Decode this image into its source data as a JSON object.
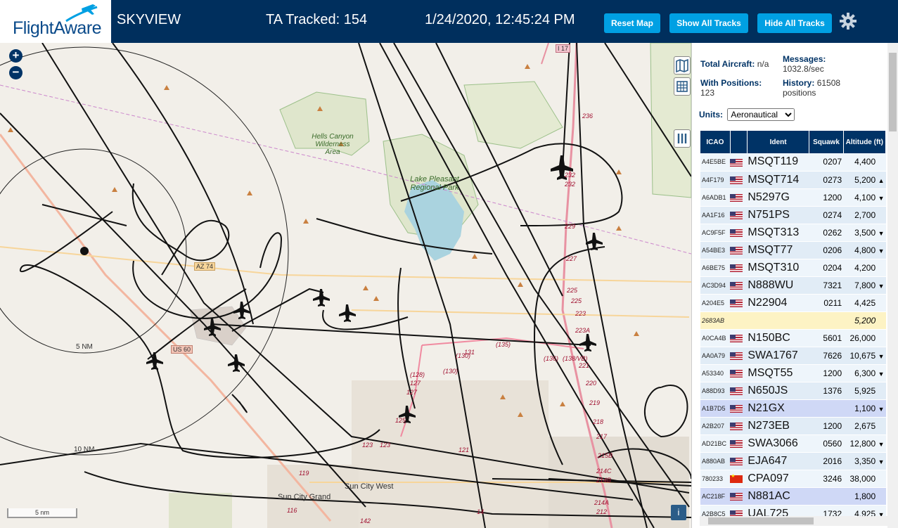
{
  "header": {
    "logo": "FlightAware",
    "app_name": "SKYVIEW",
    "tracked": "TA Tracked: 154",
    "datetime": "1/24/2020, 12:45:24 PM",
    "reset_label": "Reset Map",
    "show_label": "Show All Tracks",
    "hide_label": "Hide All Tracks",
    "accent": "#00a0e3",
    "bar_color": "#002f5d"
  },
  "map": {
    "labels": {
      "hells_canyon": "Hells Canyon Wilderness Area",
      "lake_pleasant": "Lake Pleasant Regional Park",
      "sun_city_west": "Sun City West",
      "sun_city_grand": "Sun City Grand",
      "ring_5": "5 NM",
      "ring_10": "10 NM",
      "az74": "AZ 74",
      "us60": "US 60",
      "i17": "I 17"
    },
    "scale": "5 nm",
    "info": "i",
    "zoom_in": "+",
    "zoom_out": "−"
  },
  "stats": {
    "total_label": "Total Aircraft:",
    "total_value": "n/a",
    "messages_label": "Messages:",
    "messages_value": "1032.8/sec",
    "positions_label": "With Positions:",
    "positions_value": "123",
    "history_label": "History:",
    "history_value": "61508",
    "history_unit": "positions"
  },
  "units": {
    "label": "Units:",
    "selected": "Aeronautical"
  },
  "table": {
    "columns": [
      "ICAO",
      "",
      "Ident",
      "Squawk",
      "Altitude (ft)"
    ],
    "rows": [
      {
        "icao": "A4E5BE",
        "flag": "us",
        "ident": "MSQT119",
        "squawk": "0207",
        "alt": "4,400",
        "trend": "",
        "state": ""
      },
      {
        "icao": "A4F179",
        "flag": "us",
        "ident": "MSQT714",
        "squawk": "0273",
        "alt": "5,200",
        "trend": "▲",
        "state": ""
      },
      {
        "icao": "A6ADB1",
        "flag": "us",
        "ident": "N5297G",
        "squawk": "1200",
        "alt": "4,100",
        "trend": "▼",
        "state": ""
      },
      {
        "icao": "AA1F16",
        "flag": "us",
        "ident": "N751PS",
        "squawk": "0274",
        "alt": "2,700",
        "trend": "",
        "state": ""
      },
      {
        "icao": "AC9F5F",
        "flag": "us",
        "ident": "MSQT313",
        "squawk": "0262",
        "alt": "3,500",
        "trend": "▼",
        "state": ""
      },
      {
        "icao": "A54BE3",
        "flag": "us",
        "ident": "MSQT77",
        "squawk": "0206",
        "alt": "4,800",
        "trend": "▼",
        "state": ""
      },
      {
        "icao": "A6BE75",
        "flag": "us",
        "ident": "MSQT310",
        "squawk": "0204",
        "alt": "4,200",
        "trend": "",
        "state": ""
      },
      {
        "icao": "AC3D94",
        "flag": "us",
        "ident": "N888WU",
        "squawk": "7321",
        "alt": "7,800",
        "trend": "▼",
        "state": ""
      },
      {
        "icao": "A204E5",
        "flag": "us",
        "ident": "N22904",
        "squawk": "0211",
        "alt": "4,425",
        "trend": "",
        "state": ""
      },
      {
        "icao": "2683AB",
        "flag": "",
        "ident": "",
        "squawk": "",
        "alt": "5,200",
        "trend": "",
        "state": "mlat"
      },
      {
        "icao": "A0CA4B",
        "flag": "us",
        "ident": "N150BC",
        "squawk": "5601",
        "alt": "26,000",
        "trend": "",
        "state": ""
      },
      {
        "icao": "AA0A79",
        "flag": "us",
        "ident": "SWA1767",
        "squawk": "7626",
        "alt": "10,675",
        "trend": "▼",
        "state": ""
      },
      {
        "icao": "A53340",
        "flag": "us",
        "ident": "MSQT55",
        "squawk": "1200",
        "alt": "6,300",
        "trend": "▼",
        "state": ""
      },
      {
        "icao": "A88D93",
        "flag": "us",
        "ident": "N650JS",
        "squawk": "1376",
        "alt": "5,925",
        "trend": "",
        "state": ""
      },
      {
        "icao": "A1B7D5",
        "flag": "us",
        "ident": "N21GX",
        "squawk": "",
        "alt": "1,100",
        "trend": "▼",
        "state": "sel"
      },
      {
        "icao": "A2B207",
        "flag": "us",
        "ident": "N273EB",
        "squawk": "1200",
        "alt": "2,675",
        "trend": "",
        "state": ""
      },
      {
        "icao": "AD21BC",
        "flag": "us",
        "ident": "SWA3066",
        "squawk": "0560",
        "alt": "12,800",
        "trend": "▼",
        "state": ""
      },
      {
        "icao": "A880AB",
        "flag": "us",
        "ident": "EJA647",
        "squawk": "2016",
        "alt": "3,350",
        "trend": "▼",
        "state": ""
      },
      {
        "icao": "780233",
        "flag": "cn",
        "ident": "CPA097",
        "squawk": "3246",
        "alt": "38,000",
        "trend": "",
        "state": ""
      },
      {
        "icao": "AC218F",
        "flag": "us",
        "ident": "N881AC",
        "squawk": "",
        "alt": "1,800",
        "trend": "",
        "state": "sel"
      },
      {
        "icao": "A2B8C5",
        "flag": "us",
        "ident": "UAL725",
        "squawk": "1732",
        "alt": "4,925",
        "trend": "▼",
        "state": ""
      }
    ]
  }
}
